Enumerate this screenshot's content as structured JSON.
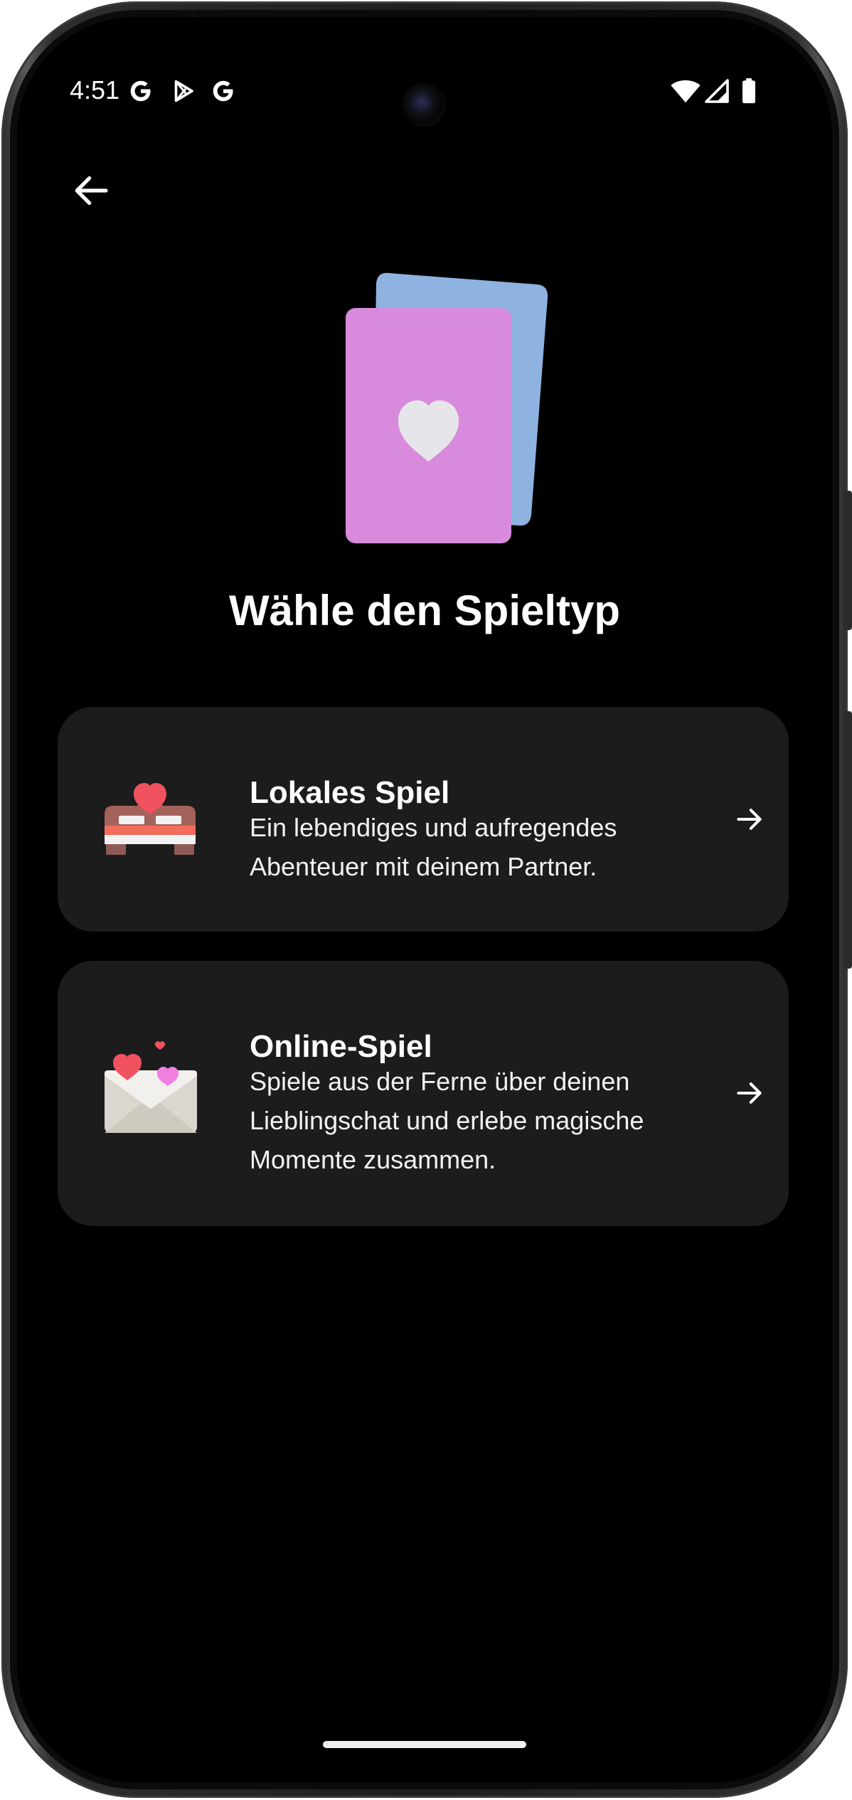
{
  "status_bar": {
    "time": "4:51",
    "left_icons": [
      "google-g-icon",
      "play-store-icon",
      "google-g-icon"
    ],
    "right_icons": [
      "wifi-icon",
      "cellular-signal-icon",
      "battery-icon"
    ]
  },
  "header": {
    "back_icon": "arrow-left-icon"
  },
  "hero": {
    "icon": "playing-cards-heart-icon",
    "colors": {
      "front_card": "#D88BDC",
      "back_card": "#8FB3E0",
      "heart": "#E6E6EA"
    }
  },
  "page": {
    "title": "Wähle den Spieltyp"
  },
  "options": [
    {
      "icon": "bed-with-heart-icon",
      "title": "Lokales Spiel",
      "description": "Ein lebendiges und aufregendes Abenteuer mit deinem Partner.",
      "arrow_icon": "arrow-right-icon"
    },
    {
      "icon": "envelope-with-hearts-icon",
      "title": "Online-Spiel",
      "description": "Spiele aus der Ferne über deinen Lieblingschat und erlebe magische Momente zusammen.",
      "arrow_icon": "arrow-right-icon"
    }
  ],
  "colors": {
    "background": "#000000",
    "card": "#1C1C1C",
    "text": "#FFFFFF"
  }
}
